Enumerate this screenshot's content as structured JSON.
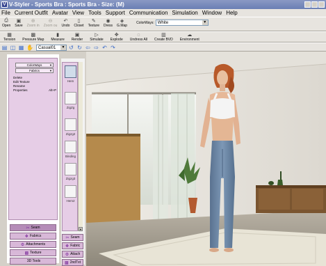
{
  "window": {
    "title": "V-Styler - Sports Bra : Sports Bra - Size: (M)",
    "app_icon": "V"
  },
  "menu": [
    "File",
    "Current Outfit",
    "Avatar",
    "View",
    "Tools",
    "Support",
    "Communication",
    "Simulation",
    "Window",
    "Help"
  ],
  "toolbar1": {
    "tools": [
      {
        "label": "Open",
        "icon": "open-icon",
        "glyph": "⎙",
        "enabled": true
      },
      {
        "label": "Save",
        "icon": "save-icon",
        "glyph": "▣",
        "enabled": true
      },
      {
        "label": "Zoom in",
        "icon": "zoom-in-icon",
        "glyph": "⊕",
        "enabled": false
      },
      {
        "label": "Zoom ou",
        "icon": "zoom-out-icon",
        "glyph": "⊖",
        "enabled": false
      },
      {
        "label": "Undo",
        "icon": "undo-icon",
        "glyph": "↶",
        "enabled": true
      },
      {
        "label": "Closet",
        "icon": "closet-icon",
        "glyph": "▯",
        "enabled": true
      },
      {
        "label": "Texture",
        "icon": "texture-icon",
        "glyph": "✎",
        "enabled": true
      },
      {
        "label": "Dress",
        "icon": "dress-icon",
        "glyph": "◉",
        "enabled": true
      },
      {
        "label": "G.Map",
        "icon": "gmap-icon",
        "glyph": "◈",
        "enabled": true
      }
    ],
    "colorways_label": "ColorWays:",
    "colorways_value": "White"
  },
  "toolbar2": {
    "tools": [
      {
        "label": "Tension",
        "icon": "tension-icon",
        "glyph": "▦"
      },
      {
        "label": "Pressure Map",
        "icon": "pressure-map-icon",
        "glyph": "▩"
      },
      {
        "label": "Measure",
        "icon": "measure-icon",
        "glyph": "▮"
      },
      {
        "label": "Render",
        "icon": "render-icon",
        "glyph": "▣"
      },
      {
        "label": "Simulate",
        "icon": "simulate-icon",
        "glyph": "▷"
      },
      {
        "label": "Explode",
        "icon": "explode-icon",
        "glyph": "✥"
      },
      {
        "label": "Undress All",
        "icon": "undress-all-icon",
        "glyph": "◌"
      },
      {
        "label": "Create BVD",
        "icon": "create-bvd-icon",
        "glyph": "▥"
      },
      {
        "label": "Environment",
        "icon": "environment-icon",
        "glyph": "☁"
      }
    ]
  },
  "toolbar3": {
    "icons": [
      {
        "name": "layer-icon",
        "glyph": "▤"
      },
      {
        "name": "camera-icon",
        "glyph": "◫"
      },
      {
        "name": "grid-icon",
        "glyph": "▦"
      },
      {
        "name": "hand-icon",
        "glyph": "✋"
      },
      {
        "name": "rotate-left-icon",
        "glyph": "↺"
      },
      {
        "name": "rotate-right-icon",
        "glyph": "↻"
      },
      {
        "name": "arrow-left-icon",
        "glyph": "⇦"
      },
      {
        "name": "arrow-right-icon",
        "glyph": "⇨"
      },
      {
        "name": "orbit-left-icon",
        "glyph": "↶"
      },
      {
        "name": "orbit-right-icon",
        "glyph": "↷"
      }
    ],
    "camera_value": "Casual01"
  },
  "left_panel": {
    "dropdown1": "ColorWays",
    "dropdown2": "Fabrics",
    "menu_items": [
      {
        "label": "Delete",
        "shortcut": ""
      },
      {
        "label": "Edit Texture",
        "shortcut": ""
      },
      {
        "label": "Rename",
        "shortcut": ""
      },
      {
        "label": "Properties",
        "shortcut": "Alt+P"
      }
    ],
    "buttons": [
      {
        "label": "Seam",
        "icon": "seam-icon",
        "glyph": "✂",
        "highlight": true
      },
      {
        "label": "Fabrics",
        "icon": "fabrics-icon",
        "glyph": "❖",
        "highlight": false
      },
      {
        "label": "Attachments",
        "icon": "attachments-icon",
        "glyph": "⚙",
        "highlight": false
      },
      {
        "label": "Texture",
        "icon": "texture-tab-icon",
        "glyph": "▩",
        "highlight": false
      },
      {
        "label": "3D Tools",
        "icon": "3d-tools-icon",
        "glyph": "",
        "highlight": false
      }
    ]
  },
  "middle_strip": {
    "patterns": [
      {
        "label": "Hem",
        "selected": true
      },
      {
        "label": "ZigZg",
        "selected": false
      },
      {
        "label": "Zigzg2",
        "selected": false
      },
      {
        "label": "Binding",
        "selected": false
      },
      {
        "label": "Zigzg3",
        "selected": false
      },
      {
        "label": "Hem2",
        "selected": false
      }
    ],
    "buttons": [
      {
        "label": "Seam",
        "icon": "seam-small-icon",
        "glyph": "✂"
      },
      {
        "label": "Fabric",
        "icon": "fabric-small-icon",
        "glyph": "❖"
      },
      {
        "label": "Attach",
        "icon": "attach-small-icon",
        "glyph": "⚙"
      },
      {
        "label": "2ndTxt",
        "icon": "2nd-texture-icon",
        "glyph": "▩"
      }
    ]
  },
  "colors": {
    "titlebar": "#6a7fb4",
    "panel_pink": "#e6cde6",
    "jeans": "#6f88a6",
    "hair": "#b85a2a"
  }
}
